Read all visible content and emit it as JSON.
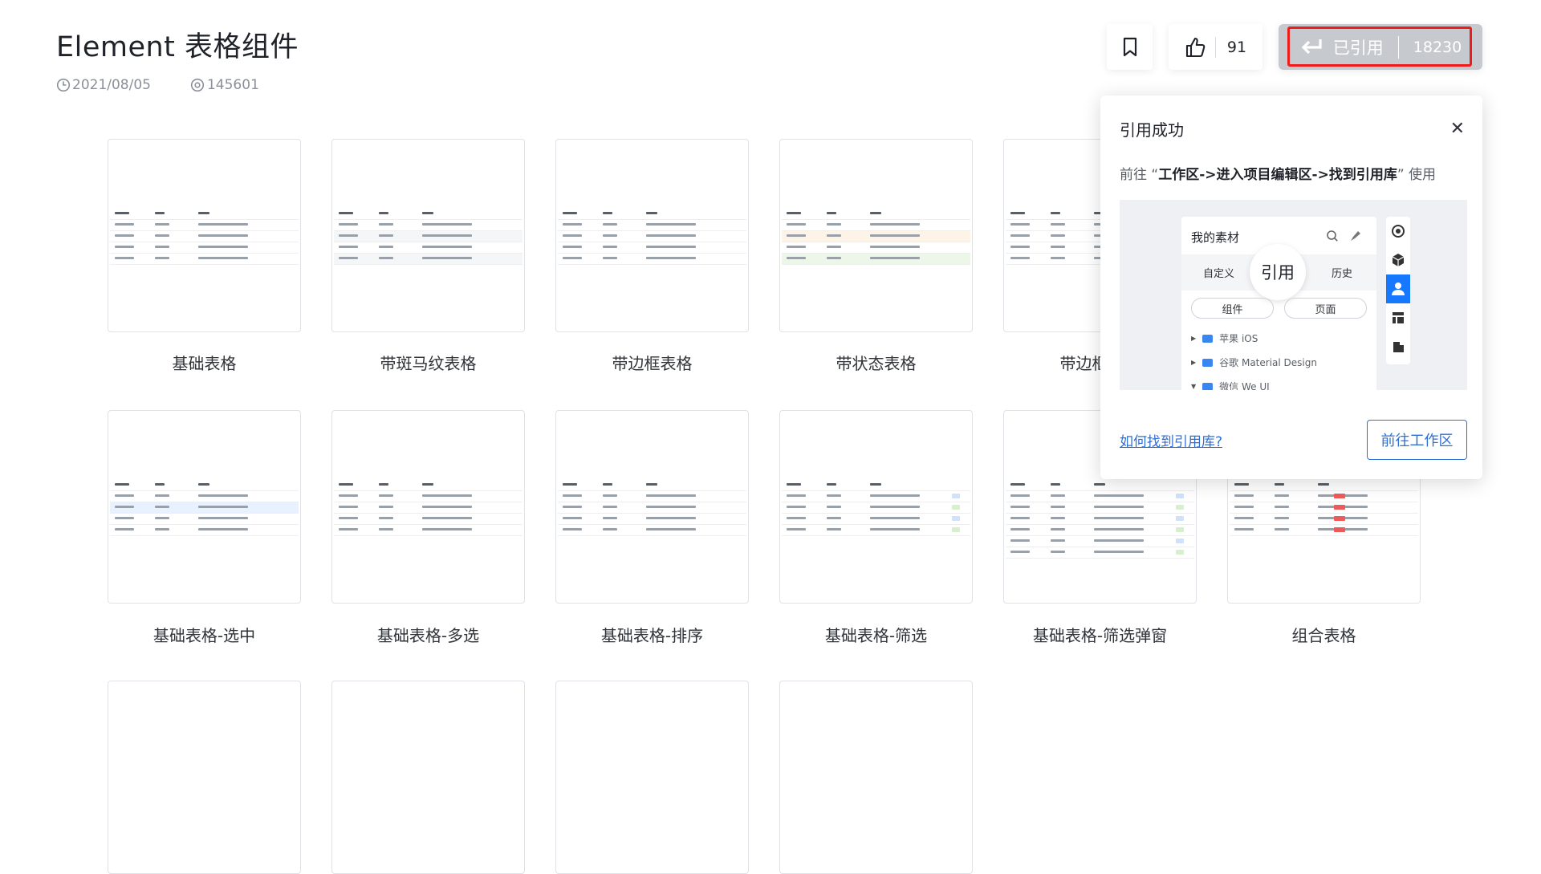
{
  "page": {
    "title": "Element 表格组件",
    "date": "2021/08/05",
    "views": "145601"
  },
  "actions": {
    "bookmark_icon": "bookmark-icon",
    "like_icon": "thumbs-up-icon",
    "like_count": "91",
    "cite_icon": "enter-return-icon",
    "cite_label": "已引用",
    "cite_count": "18230",
    "cite_highlight_color": "#ee1c1c"
  },
  "cards": [
    {
      "label": "基础表格"
    },
    {
      "label": "带斑马纹表格"
    },
    {
      "label": "带边框表格"
    },
    {
      "label": "带状态表格"
    },
    {
      "label": "带边框表格"
    },
    {
      "label": "基础表格-选中"
    },
    {
      "label": "基础表格-多选"
    },
    {
      "label": "基础表格-排序"
    },
    {
      "label": "基础表格-筛选"
    },
    {
      "label": "基础表格-筛选弹窗"
    },
    {
      "label": "组合表格"
    }
  ],
  "popup": {
    "title": "引用成功",
    "close_icon": "close-icon",
    "desc_prefix": "前往 “",
    "desc_path": "工作区->进入项目编辑区->找到引用库",
    "desc_suffix": "” 使用",
    "preview": {
      "panel_title": "我的素材",
      "tabs": [
        "自定义",
        "引用",
        "历史"
      ],
      "pills": [
        "组件",
        "页面"
      ],
      "tree": [
        "苹果 iOS",
        "谷歌 Material Design",
        "微信 We UI"
      ]
    },
    "help_link": "如何找到引用库?",
    "go_button": "前往工作区"
  },
  "colors": {
    "accent": "#2e6fd6",
    "cite_bg": "#c6cacf",
    "sidebar_active": "#1677ff"
  }
}
